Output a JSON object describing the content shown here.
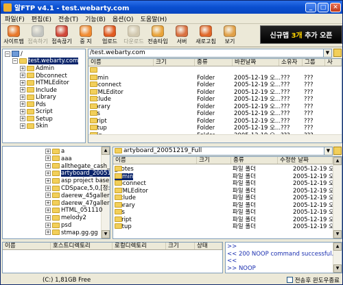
{
  "window": {
    "title": "알FTP v4.1 - test.webarty.com"
  },
  "menu": [
    "파일(F)",
    "편집(E)",
    "전송(T)",
    "기능(B)",
    "옵션(O)",
    "도움말(H)"
  ],
  "toolbar": [
    {
      "label": "사이트맵",
      "icon": "sitemap-icon",
      "color": "#e8772a",
      "enabled": true
    },
    {
      "label": "접속하기",
      "icon": "connect-icon",
      "color": "#9aa0a8",
      "enabled": false
    },
    {
      "label": "접속끊기",
      "icon": "disconnect-icon",
      "color": "#d04838",
      "enabled": true
    },
    {
      "label": "중 지",
      "icon": "stop-icon",
      "color": "#f08a30",
      "enabled": true
    },
    {
      "label": "업로드",
      "icon": "upload-icon",
      "color": "#e05a20",
      "enabled": true
    },
    {
      "label": "다운로드",
      "icon": "download-icon",
      "color": "#b8a888",
      "enabled": false
    },
    {
      "label": "전송타입",
      "icon": "transfer-type-icon",
      "color": "#e8a33a",
      "enabled": true
    },
    {
      "label": "서버",
      "icon": "server-icon",
      "color": "#d87040",
      "enabled": true
    },
    {
      "label": "새로고침",
      "icon": "refresh-icon",
      "color": "#e06628",
      "enabled": true
    },
    {
      "label": "보기",
      "icon": "view-icon",
      "color": "#e0a048",
      "enabled": true
    }
  ],
  "ad": {
    "prefix": "신규맵",
    "highlight": "3개",
    "suffix": "추가 오픈"
  },
  "remote_tree": {
    "root": "/",
    "host": "test.webarty.com",
    "items": [
      "Admin",
      "Dbconnect",
      "HTMLEditor",
      "Include",
      "Library",
      "Pds",
      "Script",
      "Setup",
      "Skin"
    ]
  },
  "remote_list": {
    "path": "/test.webarty.com",
    "columns": [
      "이름",
      "크기",
      "종류",
      "바뀐날짜",
      "소유자",
      "그룹",
      "사"
    ],
    "rows": [
      {
        "name": "..",
        "type": "",
        "date": "",
        "owner": "",
        "group": ""
      },
      {
        "name": "Admin",
        "type": "Folder",
        "date": "2005-12-19 오...",
        "owner": "???",
        "group": "???"
      },
      {
        "name": "Dbconnect",
        "type": "Folder",
        "date": "2005-12-19 오...",
        "owner": "???",
        "group": "???"
      },
      {
        "name": "HTMLEditor",
        "type": "Folder",
        "date": "2005-12-19 오...",
        "owner": "???",
        "group": "???"
      },
      {
        "name": "Include",
        "type": "Folder",
        "date": "2005-12-19 오...",
        "owner": "???",
        "group": "???"
      },
      {
        "name": "Library",
        "type": "Folder",
        "date": "2005-12-19 오...",
        "owner": "???",
        "group": "???"
      },
      {
        "name": "Pds",
        "type": "Folder",
        "date": "2005-12-19 오...",
        "owner": "???",
        "group": "???"
      },
      {
        "name": "Script",
        "type": "Folder",
        "date": "2005-12-19 오...",
        "owner": "???",
        "group": "???"
      },
      {
        "name": "Setup",
        "type": "Folder",
        "date": "2005-12-19 오...",
        "owner": "???",
        "group": "???"
      },
      {
        "name": "Skin",
        "type": "Folder",
        "date": "2005-12-19 오...",
        "owner": "???",
        "group": "???"
      }
    ]
  },
  "local_tree": {
    "items": [
      "a",
      "aaa",
      "allthegate_cash_r",
      "artyboard_2005121",
      "asp project base",
      "CDSpace,5,0,[정:",
      "daerew_45gallery",
      "daerew_47gallery",
      "HTML_051110",
      "melody2",
      "psd",
      "stmap.gg.gg"
    ],
    "selected": 3
  },
  "local_list": {
    "path": "artyboard_20051219_Full",
    "columns": [
      "이름",
      "크기",
      "종류",
      "수정한 날짜"
    ],
    "rows": [
      {
        "name": "_notes",
        "type": "파일 폴더",
        "date": "2005-12-19 오후"
      },
      {
        "name": "Admin",
        "type": "파일 폴더",
        "date": "2005-12-19 오후"
      },
      {
        "name": "Dbconnect",
        "type": "파일 폴더",
        "date": "2005-12-19 오후"
      },
      {
        "name": "HTMLEditor",
        "type": "파일 폴더",
        "date": "2005-12-19 오후"
      },
      {
        "name": "Include",
        "type": "파일 폴더",
        "date": "2005-12-19 오후"
      },
      {
        "name": "Library",
        "type": "파일 폴더",
        "date": "2005-12-19 오후"
      },
      {
        "name": "Pds",
        "type": "파일 폴더",
        "date": "2005-12-19 오후"
      },
      {
        "name": "Script",
        "type": "파일 폴더",
        "date": "2005-12-19 오후"
      },
      {
        "name": "Setup",
        "type": "파일 폴더",
        "date": "2005-12-19 오후"
      }
    ],
    "selected": 1
  },
  "queue": {
    "columns": [
      "이름",
      "호스트디렉토리",
      "로컬디렉토리",
      "크기",
      "상태"
    ]
  },
  "log": [
    ">>",
    "<< 200 NOOP command successful.",
    "<<",
    ">> NOOP"
  ],
  "status": {
    "drive": "(C:) 1,81GB Free",
    "shutdown_label": "전송후 윈도우종료"
  }
}
